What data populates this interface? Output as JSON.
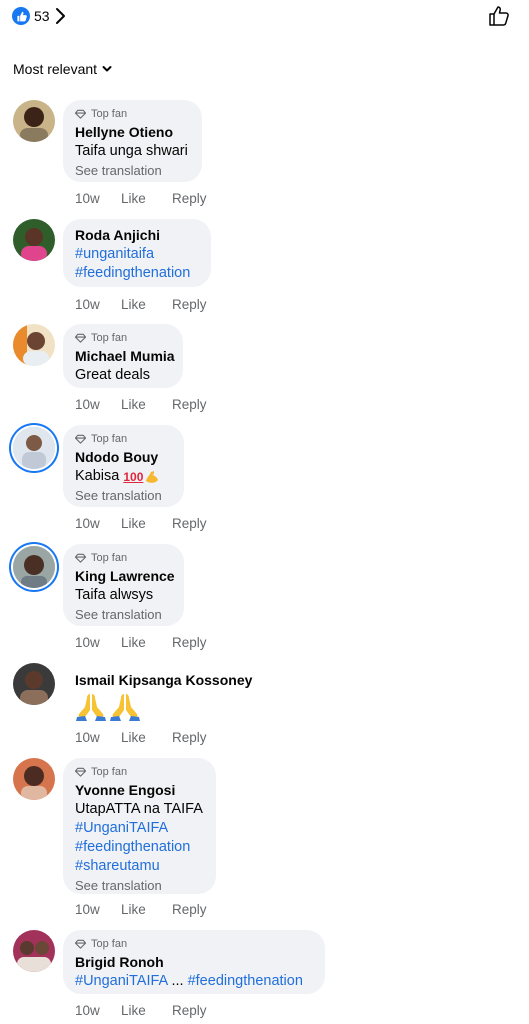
{
  "header": {
    "reaction_count": "53",
    "sort_label": "Most relevant"
  },
  "comments": [
    {
      "badge": "Top fan",
      "author": "Hellyne Otieno",
      "lines": [
        "Taifa unga shwari"
      ],
      "see_translation": "See translation",
      "time": "10w",
      "like": "Like",
      "reply": "Reply"
    },
    {
      "author": "Roda Anjichi",
      "lines": [
        "#unganitaifa",
        "#feedingthenation"
      ],
      "time": "10w",
      "like": "Like",
      "reply": "Reply"
    },
    {
      "badge": "Top fan",
      "author": "Michael Mumia",
      "lines": [
        "Great deals"
      ],
      "time": "10w",
      "like": "Like",
      "reply": "Reply"
    },
    {
      "badge": "Top fan",
      "author": "Ndodo Bouy",
      "lines": [
        "Kabisa"
      ],
      "see_translation": "See translation",
      "time": "10w",
      "like": "Like",
      "reply": "Reply"
    },
    {
      "badge": "Top fan",
      "author": "King Lawrence",
      "lines": [
        "Taifa alwsys"
      ],
      "see_translation": "See translation",
      "time": "10w",
      "like": "Like",
      "reply": "Reply"
    },
    {
      "author": "Ismail Kipsanga Kossoney",
      "time": "10w",
      "like": "Like",
      "reply": "Reply"
    },
    {
      "badge": "Top fan",
      "author": "Yvonne Engosi",
      "lines": [
        "UtapATTA na TAIFA",
        "#UnganiTAIFA",
        "#feedingthenation",
        "#shareutamu"
      ],
      "see_translation": "See translation",
      "time": "10w",
      "like": "Like",
      "reply": "Reply"
    },
    {
      "badge": "Top fan",
      "author": "Brigid Ronoh",
      "lines": [
        "#UnganiTAIFA",
        "...",
        "#feedingthenation"
      ],
      "time": "10w",
      "like": "Like",
      "reply": "Reply"
    }
  ],
  "icons": {
    "reaction": "like-reaction-icon",
    "chevron": "chevron-right-icon",
    "thumb": "thumbs-up-outline-icon",
    "sort_chevron": "chevron-down-icon",
    "badge": "diamond-icon"
  },
  "colors": {
    "accent": "#1877f2",
    "hashtag": "#216fdb",
    "bubble": "#f0f2f5",
    "muted": "#65676b"
  }
}
